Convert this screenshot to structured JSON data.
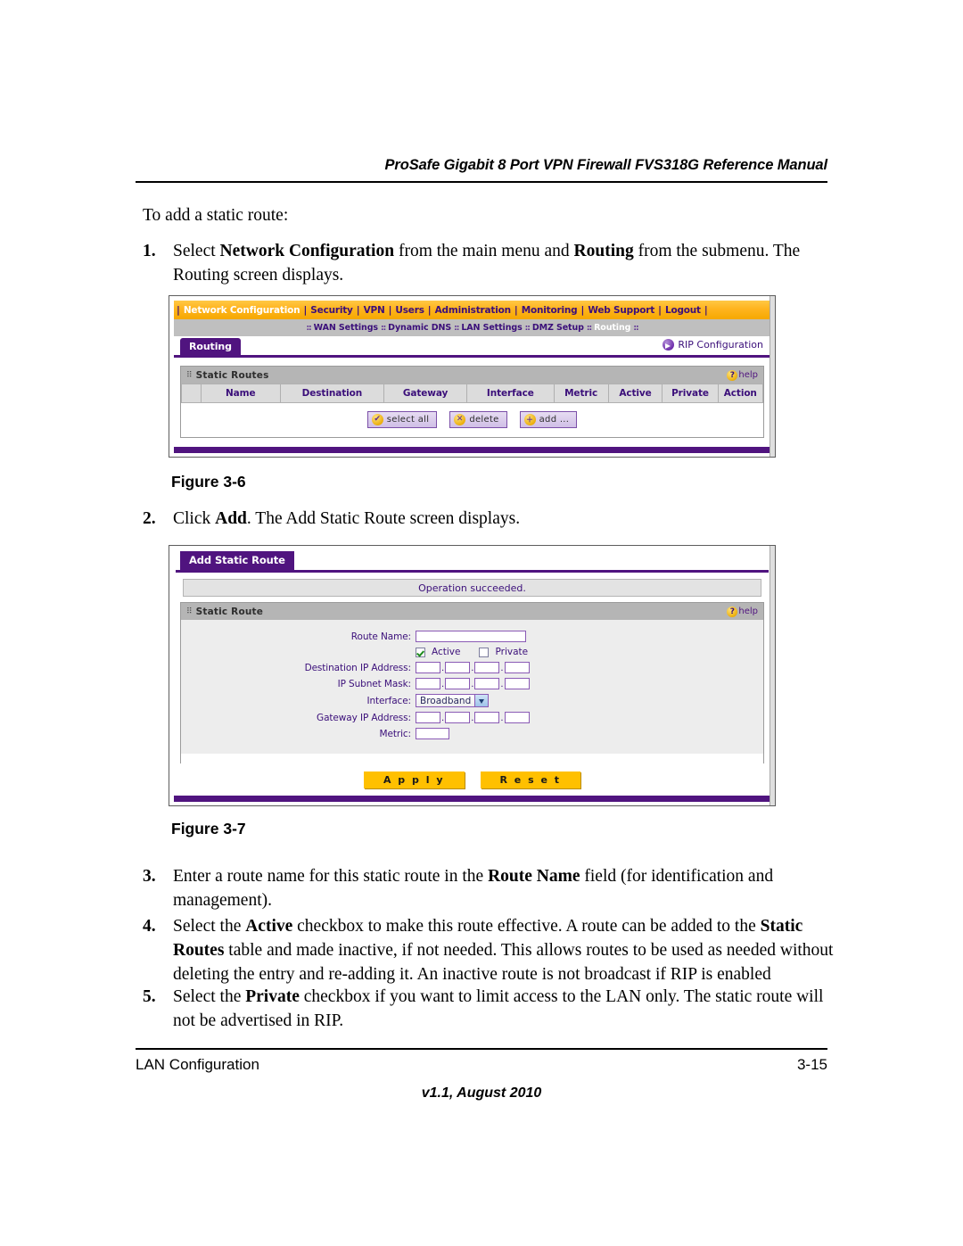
{
  "header": {
    "running_head": "ProSafe Gigabit 8 Port VPN Firewall FVS318G Reference Manual"
  },
  "body": {
    "intro": "To add a static route:",
    "steps": [
      {
        "num": "1.",
        "parts": [
          {
            "t": "Select ",
            "b": false
          },
          {
            "t": "Network Configuration",
            "b": true
          },
          {
            "t": " from the main menu and ",
            "b": false
          },
          {
            "t": "Routing",
            "b": true
          },
          {
            "t": " from the submenu. The Routing screen displays.",
            "b": false
          }
        ]
      },
      {
        "num": "2.",
        "parts": [
          {
            "t": "Click ",
            "b": false
          },
          {
            "t": "Add",
            "b": true
          },
          {
            "t": ". The Add Static Route screen displays.",
            "b": false
          }
        ]
      },
      {
        "num": "3.",
        "parts": [
          {
            "t": "Enter a route name for this static route in the ",
            "b": false
          },
          {
            "t": "Route Name",
            "b": true
          },
          {
            "t": " field (for identification and management).",
            "b": false
          }
        ]
      },
      {
        "num": "4.",
        "parts": [
          {
            "t": "Select the ",
            "b": false
          },
          {
            "t": "Active",
            "b": true
          },
          {
            "t": " checkbox to make this route effective. A route can be added to the ",
            "b": false
          },
          {
            "t": "Static Routes",
            "b": true
          },
          {
            "t": " table and made inactive, if not needed. This allows routes to be used as needed without deleting the entry and re-adding it. An inactive route is not broadcast if RIP is enabled",
            "b": false
          }
        ]
      },
      {
        "num": "5.",
        "parts": [
          {
            "t": "Select the ",
            "b": false
          },
          {
            "t": "Private",
            "b": true
          },
          {
            "t": " checkbox if you want to limit access to the LAN only. The static route will not be advertised in RIP.",
            "b": false
          }
        ]
      }
    ]
  },
  "figures": {
    "fig36_caption": "Figure 3-6",
    "fig37_caption": "Figure 3-7"
  },
  "routing_screen": {
    "main_menu": [
      {
        "label": "Network Configuration",
        "selected": true
      },
      {
        "label": "Security",
        "selected": false
      },
      {
        "label": "VPN",
        "selected": false
      },
      {
        "label": "Users",
        "selected": false
      },
      {
        "label": "Administration",
        "selected": false
      },
      {
        "label": "Monitoring",
        "selected": false
      },
      {
        "label": "Web Support",
        "selected": false
      },
      {
        "label": "Logout",
        "selected": false
      }
    ],
    "submenu": [
      {
        "label": "WAN Settings",
        "selected": false
      },
      {
        "label": "Dynamic DNS",
        "selected": false
      },
      {
        "label": "LAN Settings",
        "selected": false
      },
      {
        "label": "DMZ Setup",
        "selected": false
      },
      {
        "label": "Routing",
        "selected": true
      }
    ],
    "tab_label": "Routing",
    "rip_link": "RIP Configuration",
    "panel_title": "Static Routes",
    "help_label": "help",
    "help_icon": "question-mark-icon",
    "table_headers": [
      "Name",
      "Destination",
      "Gateway",
      "Interface",
      "Metric",
      "Active",
      "Private",
      "Action"
    ],
    "buttons": [
      {
        "label": "select all",
        "icon": "check-circle-icon",
        "glyph": "✔"
      },
      {
        "label": "delete",
        "icon": "x-circle-icon",
        "glyph": "✕"
      },
      {
        "label": "add ...",
        "icon": "plus-circle-icon",
        "glyph": "＋"
      }
    ]
  },
  "add_static_route_screen": {
    "tab_label": "Add Static Route",
    "status_message": "Operation succeeded.",
    "panel_title": "Static Route",
    "help_label": "help",
    "fields": {
      "route_name_label": "Route Name:",
      "route_name_value": "",
      "active_label": "Active",
      "active_checked": true,
      "private_label": "Private",
      "private_checked": false,
      "destination_label": "Destination IP Address:",
      "destination_octets": [
        "",
        "",
        "",
        ""
      ],
      "subnet_label": "IP Subnet Mask:",
      "subnet_octets": [
        "",
        "",
        "",
        ""
      ],
      "interface_label": "Interface:",
      "interface_value": "Broadband",
      "gateway_label": "Gateway IP Address:",
      "gateway_octets": [
        "",
        "",
        "",
        ""
      ],
      "metric_label": "Metric:",
      "metric_value": ""
    },
    "apply_label": "A p p l y",
    "reset_label": "R e s e t"
  },
  "footer": {
    "left": "LAN Configuration",
    "right": "3-15",
    "center": "v1.1, August 2010"
  },
  "colors": {
    "nav_orange": "#ffb41e",
    "purple": "#50147f",
    "panel_grey": "#b5b5b5",
    "button_yellow": "#ffc000"
  }
}
